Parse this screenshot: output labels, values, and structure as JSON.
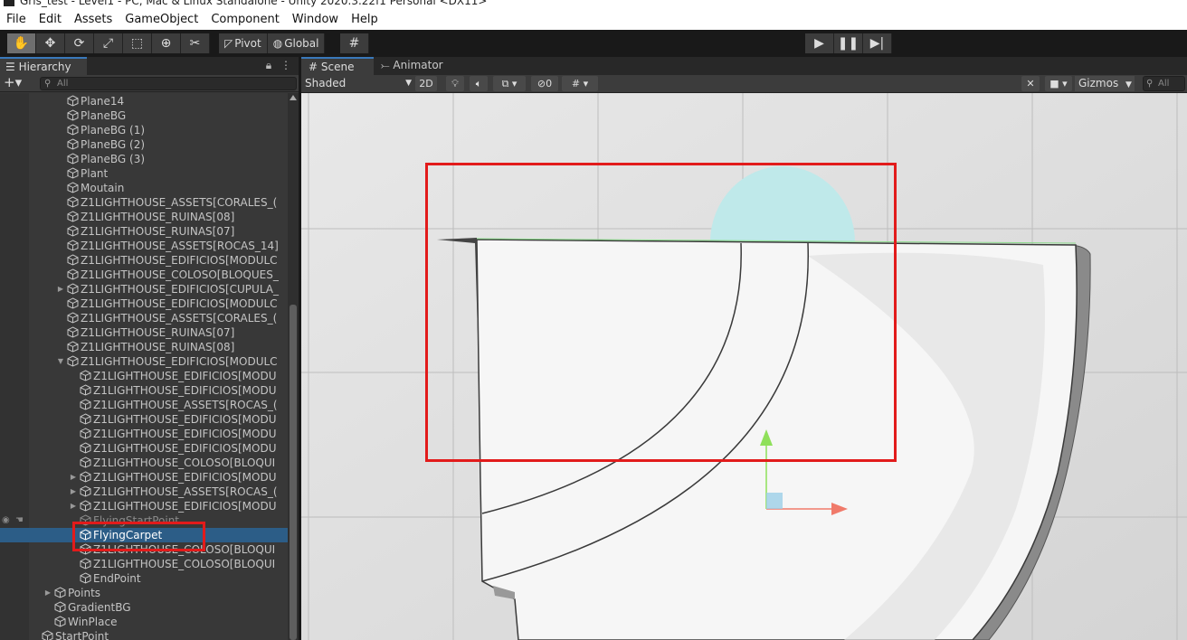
{
  "window": {
    "title": "Gris_test - Level1 - PC, Mac & Linux Standalone - Unity 2020.3.22f1 Personal <DX11>"
  },
  "menu": [
    "File",
    "Edit",
    "Assets",
    "GameObject",
    "Component",
    "Window",
    "Help"
  ],
  "toolbar": {
    "tools": [
      "hand-tool-icon",
      "move-tool-icon",
      "rotate-tool-icon",
      "scale-tool-icon",
      "rect-tool-icon",
      "transform-tool-icon",
      "custom-tool-icon"
    ],
    "pivot_label": "Pivot",
    "global_label": "Global",
    "snap_icon": "grid-snap-icon",
    "play_controls": [
      "play-icon",
      "pause-icon",
      "step-icon"
    ]
  },
  "hierarchy": {
    "tab_label": "Hierarchy",
    "add_label": "+▾",
    "search_placeholder": "All",
    "items": [
      {
        "label": "Plane14",
        "depth": 2,
        "fold": ""
      },
      {
        "label": "PlaneBG",
        "depth": 2,
        "fold": ""
      },
      {
        "label": "PlaneBG (1)",
        "depth": 2,
        "fold": ""
      },
      {
        "label": "PlaneBG (2)",
        "depth": 2,
        "fold": ""
      },
      {
        "label": "PlaneBG (3)",
        "depth": 2,
        "fold": ""
      },
      {
        "label": "Plant",
        "depth": 2,
        "fold": ""
      },
      {
        "label": "Moutain",
        "depth": 2,
        "fold": ""
      },
      {
        "label": "Z1LIGHTHOUSE_ASSETS[CORALES_(",
        "depth": 2,
        "fold": ""
      },
      {
        "label": "Z1LIGHTHOUSE_RUINAS[08]",
        "depth": 2,
        "fold": ""
      },
      {
        "label": "Z1LIGHTHOUSE_RUINAS[07]",
        "depth": 2,
        "fold": ""
      },
      {
        "label": "Z1LIGHTHOUSE_ASSETS[ROCAS_14]",
        "depth": 2,
        "fold": ""
      },
      {
        "label": "Z1LIGHTHOUSE_EDIFICIOS[MODULC",
        "depth": 2,
        "fold": ""
      },
      {
        "label": "Z1LIGHTHOUSE_COLOSO[BLOQUES_",
        "depth": 2,
        "fold": ""
      },
      {
        "label": "Z1LIGHTHOUSE_EDIFICIOS[CUPULA_",
        "depth": 2,
        "fold": "▶"
      },
      {
        "label": "Z1LIGHTHOUSE_EDIFICIOS[MODULC",
        "depth": 2,
        "fold": ""
      },
      {
        "label": "Z1LIGHTHOUSE_ASSETS[CORALES_(",
        "depth": 2,
        "fold": ""
      },
      {
        "label": "Z1LIGHTHOUSE_RUINAS[07]",
        "depth": 2,
        "fold": ""
      },
      {
        "label": "Z1LIGHTHOUSE_RUINAS[08]",
        "depth": 2,
        "fold": ""
      },
      {
        "label": "Z1LIGHTHOUSE_EDIFICIOS[MODULC",
        "depth": 2,
        "fold": "▼"
      },
      {
        "label": "Z1LIGHTHOUSE_EDIFICIOS[MODU",
        "depth": 3,
        "fold": ""
      },
      {
        "label": "Z1LIGHTHOUSE_EDIFICIOS[MODU",
        "depth": 3,
        "fold": ""
      },
      {
        "label": "Z1LIGHTHOUSE_ASSETS[ROCAS_(",
        "depth": 3,
        "fold": ""
      },
      {
        "label": "Z1LIGHTHOUSE_EDIFICIOS[MODU",
        "depth": 3,
        "fold": ""
      },
      {
        "label": "Z1LIGHTHOUSE_EDIFICIOS[MODU",
        "depth": 3,
        "fold": ""
      },
      {
        "label": "Z1LIGHTHOUSE_EDIFICIOS[MODU",
        "depth": 3,
        "fold": ""
      },
      {
        "label": "Z1LIGHTHOUSE_COLOSO[BLOQUI",
        "depth": 3,
        "fold": ""
      },
      {
        "label": "Z1LIGHTHOUSE_EDIFICIOS[MODU",
        "depth": 3,
        "fold": "▶"
      },
      {
        "label": "Z1LIGHTHOUSE_ASSETS[ROCAS_(",
        "depth": 3,
        "fold": "▶"
      },
      {
        "label": "Z1LIGHTHOUSE_EDIFICIOS[MODU",
        "depth": 3,
        "fold": "▶"
      },
      {
        "label": "FlyingStartPoint",
        "depth": 3,
        "fold": "",
        "dim": true
      },
      {
        "label": "FlyingCarpet",
        "depth": 3,
        "fold": "",
        "selected": true
      },
      {
        "label": "Z1LIGHTHOUSE_COLOSO[BLOQUI",
        "depth": 3,
        "fold": ""
      },
      {
        "label": "Z1LIGHTHOUSE_COLOSO[BLOQUI",
        "depth": 3,
        "fold": ""
      },
      {
        "label": "EndPoint",
        "depth": 3,
        "fold": ""
      },
      {
        "label": "Points",
        "depth": 1,
        "fold": "▶"
      },
      {
        "label": "GradientBG",
        "depth": 1,
        "fold": ""
      },
      {
        "label": "WinPlace",
        "depth": 1,
        "fold": ""
      },
      {
        "label": "StartPoint",
        "depth": 0,
        "fold": ""
      }
    ]
  },
  "scene": {
    "tabs": [
      "Scene",
      "Animator"
    ],
    "shading_mode": "Shaded",
    "mode_2d": "2D",
    "hidden_count": "0",
    "gizmos_label": "Gizmos",
    "search_placeholder": "All"
  },
  "colors": {
    "accent": "#3a79bb",
    "selection": "#2c5d87",
    "annotation": "#e21b1b",
    "viewport_bg": "#e3e3e3"
  }
}
